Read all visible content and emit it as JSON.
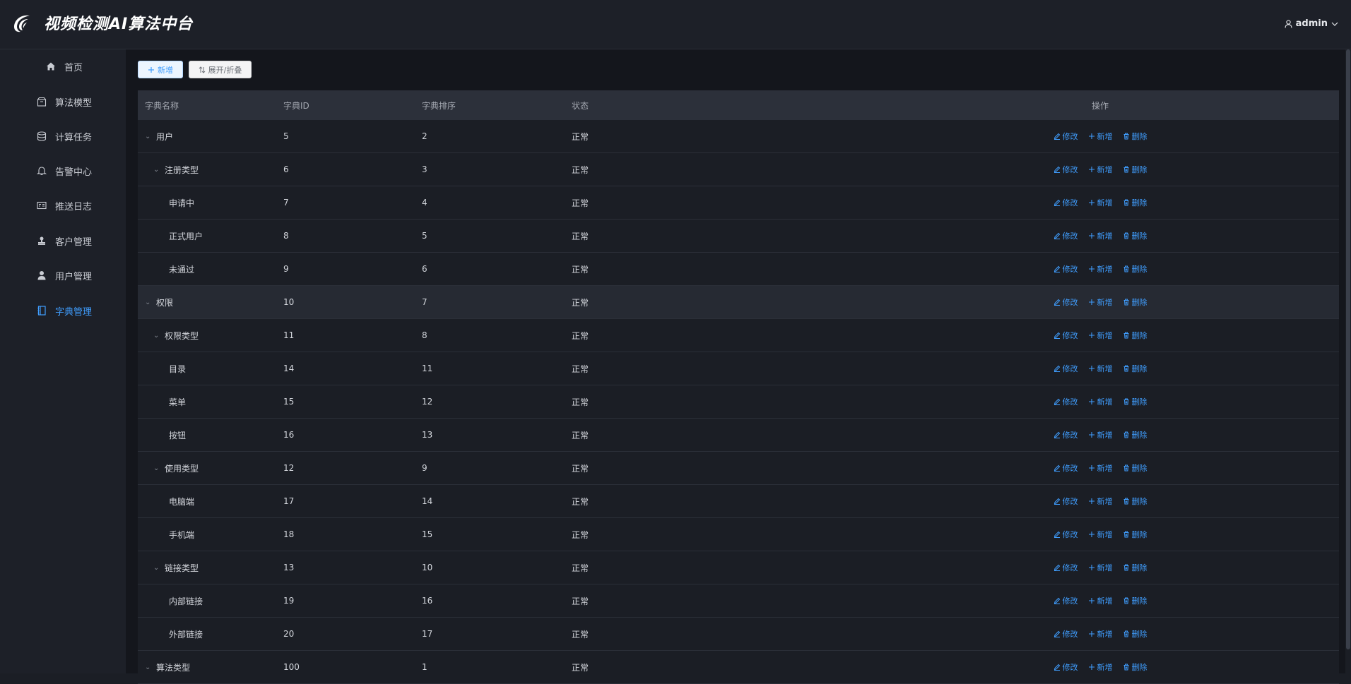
{
  "header": {
    "title": "视频检测AI算法中台",
    "user": "admin"
  },
  "sidebar": {
    "items": [
      {
        "label": "首页",
        "icon": "home-icon"
      },
      {
        "label": "算法模型",
        "icon": "box-icon"
      },
      {
        "label": "计算任务",
        "icon": "database-icon"
      },
      {
        "label": "告警中心",
        "icon": "bell-icon"
      },
      {
        "label": "推送日志",
        "icon": "id-card-icon"
      },
      {
        "label": "客户管理",
        "icon": "stamp-icon"
      },
      {
        "label": "用户管理",
        "icon": "user-icon"
      },
      {
        "label": "字典管理",
        "icon": "notebook-icon"
      }
    ],
    "active": "字典管理"
  },
  "toolbar": {
    "add_label": "新增",
    "expand_label": "展开/折叠"
  },
  "table": {
    "columns": [
      "字典名称",
      "字典ID",
      "字典排序",
      "状态",
      "操作"
    ],
    "ops": {
      "edit": "修改",
      "add": "新增",
      "delete": "删除"
    },
    "rows": [
      {
        "name": "用户",
        "id": "5",
        "sort": "2",
        "status": "正常",
        "level": 0,
        "expandable": true
      },
      {
        "name": "注册类型",
        "id": "6",
        "sort": "3",
        "status": "正常",
        "level": 1,
        "expandable": true
      },
      {
        "name": "申请中",
        "id": "7",
        "sort": "4",
        "status": "正常",
        "level": 2,
        "expandable": false
      },
      {
        "name": "正式用户",
        "id": "8",
        "sort": "5",
        "status": "正常",
        "level": 2,
        "expandable": false
      },
      {
        "name": "未通过",
        "id": "9",
        "sort": "6",
        "status": "正常",
        "level": 2,
        "expandable": false
      },
      {
        "name": "权限",
        "id": "10",
        "sort": "7",
        "status": "正常",
        "level": 0,
        "expandable": true,
        "highlight": true
      },
      {
        "name": "权限类型",
        "id": "11",
        "sort": "8",
        "status": "正常",
        "level": 1,
        "expandable": true
      },
      {
        "name": "目录",
        "id": "14",
        "sort": "11",
        "status": "正常",
        "level": 2,
        "expandable": false
      },
      {
        "name": "菜单",
        "id": "15",
        "sort": "12",
        "status": "正常",
        "level": 2,
        "expandable": false
      },
      {
        "name": "按钮",
        "id": "16",
        "sort": "13",
        "status": "正常",
        "level": 2,
        "expandable": false
      },
      {
        "name": "使用类型",
        "id": "12",
        "sort": "9",
        "status": "正常",
        "level": 1,
        "expandable": true
      },
      {
        "name": "电脑端",
        "id": "17",
        "sort": "14",
        "status": "正常",
        "level": 2,
        "expandable": false
      },
      {
        "name": "手机端",
        "id": "18",
        "sort": "15",
        "status": "正常",
        "level": 2,
        "expandable": false
      },
      {
        "name": "链接类型",
        "id": "13",
        "sort": "10",
        "status": "正常",
        "level": 1,
        "expandable": true
      },
      {
        "name": "内部链接",
        "id": "19",
        "sort": "16",
        "status": "正常",
        "level": 2,
        "expandable": false
      },
      {
        "name": "外部链接",
        "id": "20",
        "sort": "17",
        "status": "正常",
        "level": 2,
        "expandable": false
      },
      {
        "name": "算法类型",
        "id": "100",
        "sort": "1",
        "status": "正常",
        "level": 0,
        "expandable": true
      }
    ]
  },
  "colors": {
    "accent": "#409eff",
    "background": "#14161c",
    "panel": "#1d2028"
  }
}
